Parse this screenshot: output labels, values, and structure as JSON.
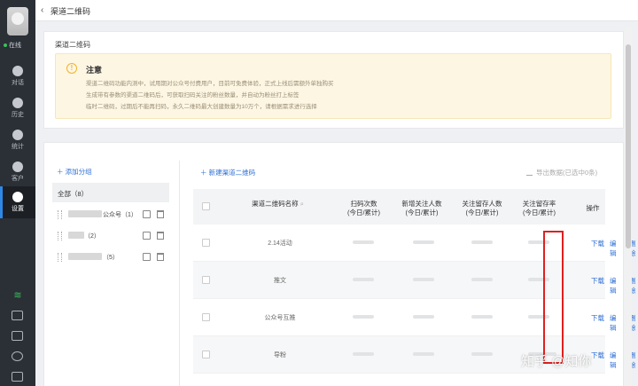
{
  "rail": {
    "status": "在线",
    "nav": [
      {
        "label": "对话",
        "icon": "chat-icon"
      },
      {
        "label": "历史",
        "icon": "history-icon"
      },
      {
        "label": "统计",
        "icon": "stats-icon"
      },
      {
        "label": "客户",
        "icon": "customer-icon"
      },
      {
        "label": "设置",
        "icon": "gear-icon",
        "active": true
      }
    ],
    "accent": "#2e88e8"
  },
  "topbar": {
    "back_icon": "chevron-left-icon",
    "title": "渠道二维码"
  },
  "notice_panel": {
    "title": "渠道二维码",
    "notice_title": "注意",
    "lines": [
      "渠道二维码功能内测中，试用期对公众号付费用户，目前可免费体验，正式上线后需额外单独购买",
      "生成带有参数的渠道二维码后，可获取扫码关注的粉丝数量，并自动为粉丝打上标签",
      "临时二维码，过期后不能再扫码，永久二维码最大创建数量为10万个，请根据需求进行选择"
    ]
  },
  "groups": {
    "add_label": "添加分组",
    "all_label": "全部（8）",
    "items": [
      {
        "suffix": "公众号（1）"
      },
      {
        "suffix": "（2）"
      },
      {
        "suffix": "（5）"
      }
    ]
  },
  "toolbar": {
    "add_label": "新建渠道二维码",
    "export_label": "导出数据(已选中0条)"
  },
  "table": {
    "headers": [
      {
        "l1": "渠道二维码名称",
        "l2": ""
      },
      {
        "l1": "扫码次数",
        "l2": "(今日/累计)"
      },
      {
        "l1": "新增关注人数",
        "l2": "(今日/累计)"
      },
      {
        "l1": "关注留存人数",
        "l2": "(今日/累计)"
      },
      {
        "l1": "关注留存率",
        "l2": "(今日/累计)"
      },
      {
        "l1": "操作",
        "l2": ""
      }
    ],
    "rows": [
      {
        "name": "2.14活动",
        "actions": [
          "下载",
          "编辑",
          "删除"
        ]
      },
      {
        "name": "推文",
        "actions": [
          "下载",
          "编辑",
          "删除"
        ]
      },
      {
        "name": "公众号互推",
        "actions": [
          "下载",
          "编辑",
          "删除"
        ]
      },
      {
        "name": "导粉",
        "actions": [
          "下载",
          "编辑",
          "删除"
        ]
      }
    ]
  },
  "watermark": "知乎 @知你",
  "highlight_color": "#e02020"
}
